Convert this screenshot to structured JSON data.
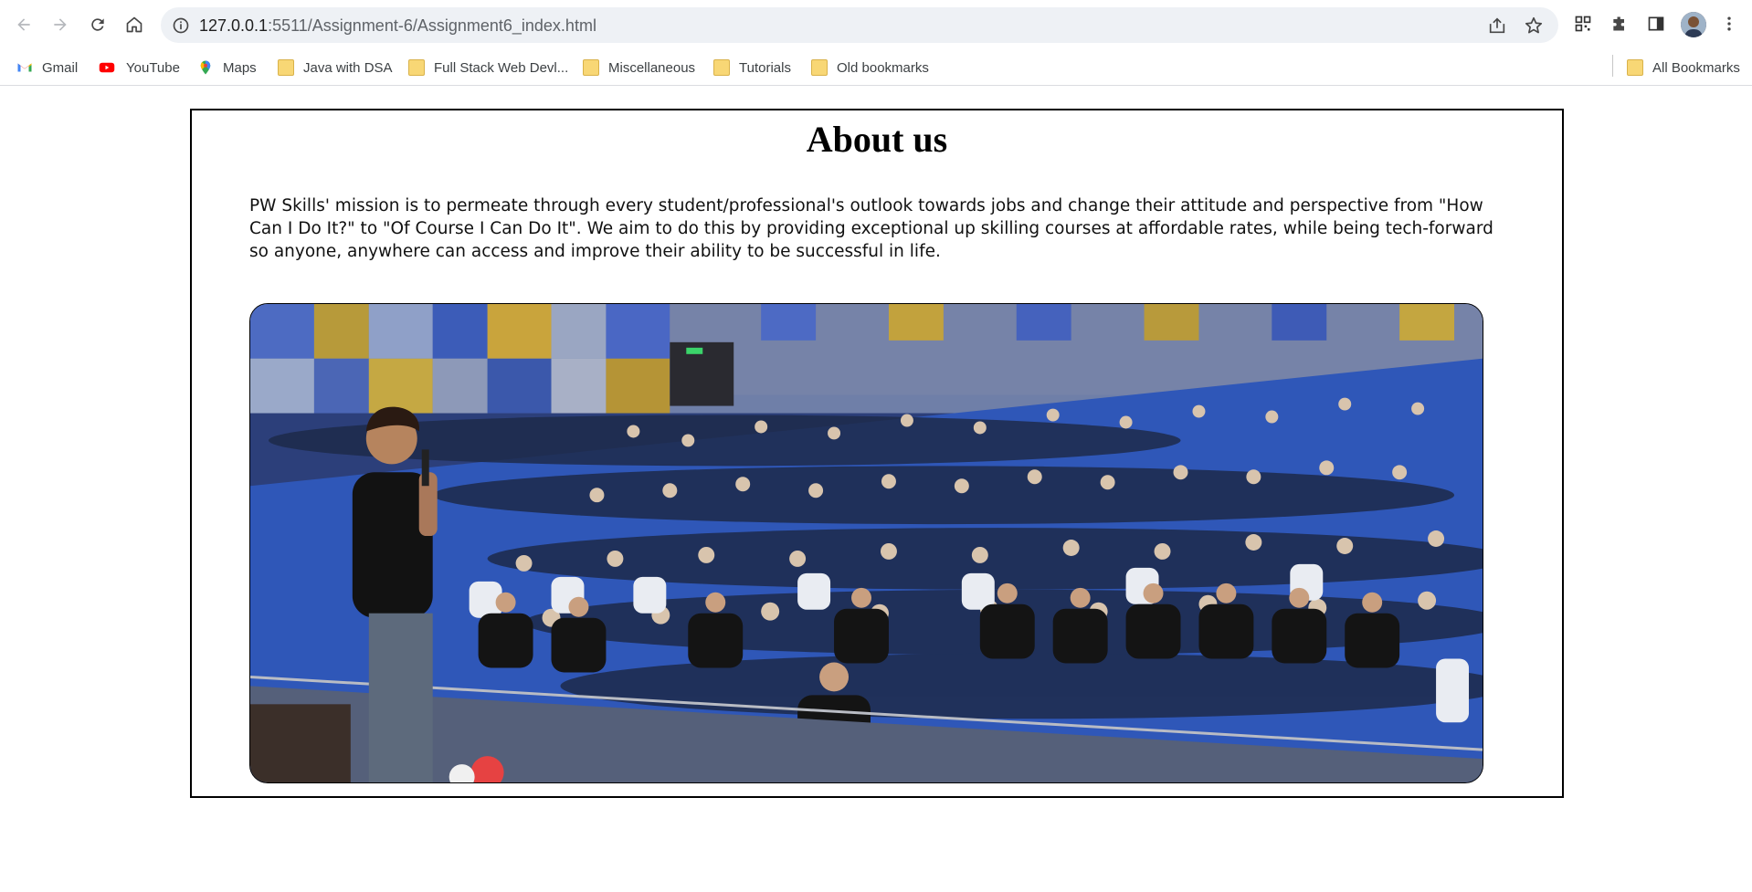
{
  "browser": {
    "url_host": "127.0.0.1",
    "url_rest": ":5511/Assignment-6/Assignment6_index.html",
    "nav_icons": [
      "back-arrow-icon",
      "forward-arrow-icon",
      "reload-icon",
      "home-icon"
    ],
    "omnibox_icons": [
      "site-info-icon",
      "share-icon",
      "star-icon"
    ],
    "toolbar_icons": [
      "qr-code-icon",
      "extensions-puzzle-icon",
      "side-panel-icon",
      "profile-avatar",
      "kebab-menu-icon"
    ]
  },
  "bookmarks": {
    "items": [
      {
        "label": "Gmail",
        "icon": "gmail-icon"
      },
      {
        "label": "YouTube",
        "icon": "youtube-icon"
      },
      {
        "label": "Maps",
        "icon": "maps-pin-icon"
      },
      {
        "label": "Java with DSA",
        "icon": "folder-icon"
      },
      {
        "label": "Full Stack Web Devl...",
        "icon": "folder-icon"
      },
      {
        "label": "Miscellaneous",
        "icon": "folder-icon"
      },
      {
        "label": "Tutorials",
        "icon": "folder-icon"
      },
      {
        "label": "Old bookmarks",
        "icon": "folder-icon"
      }
    ],
    "all_bookmarks": {
      "label": "All Bookmarks",
      "icon": "folder-icon"
    }
  },
  "page": {
    "heading": "About us",
    "mission": "PW Skills' mission is to permeate through every student/professional's outlook towards jobs and change their attitude and perspective from \"How Can I Do It?\" to \"Of Course I Can Do It\". We aim to do this by providing exceptional up skilling courses at affordable rates, while being tech-forward so anyone, anywhere can access and improve their ability to be successful in life.",
    "photo_icon": "auditorium-photo"
  },
  "colors": {
    "accent_blue": "#1a73e8",
    "chrome_bg": "#ffffff",
    "omnibox_bg": "#eef1f5",
    "seat_blue": "#2f57b8",
    "folder_yellow": "#f8d775",
    "youtube_red": "#ff0000"
  }
}
